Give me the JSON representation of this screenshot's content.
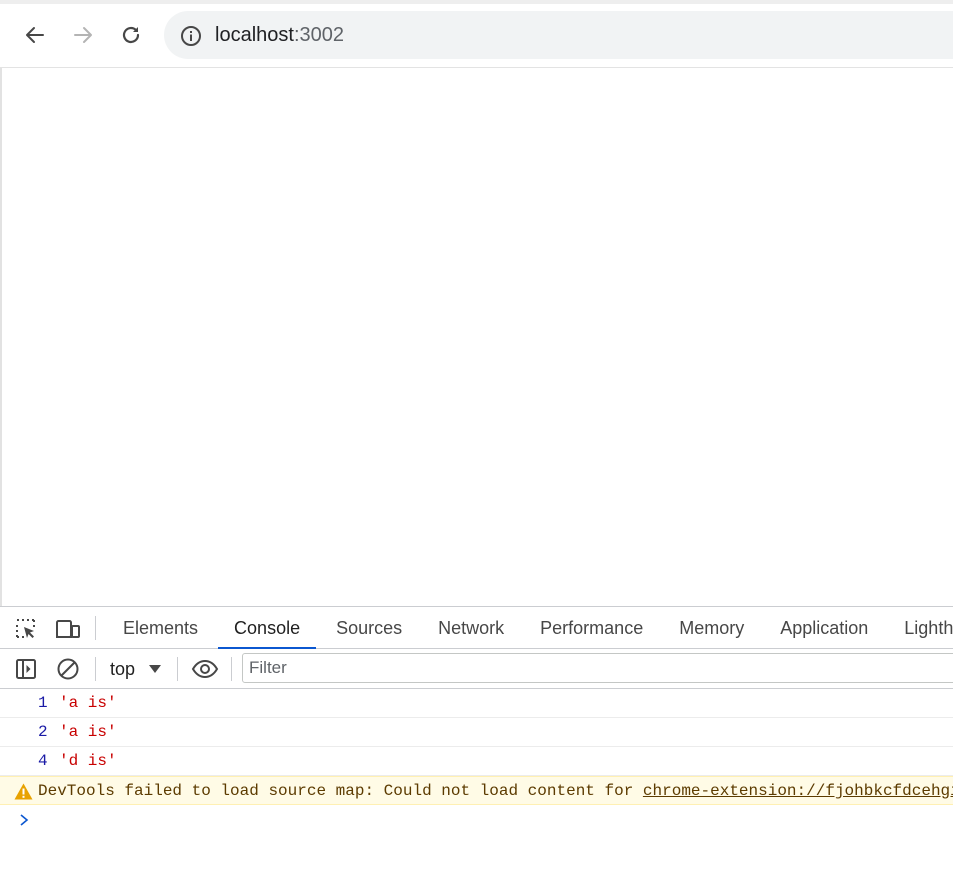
{
  "browser": {
    "url_host": "localhost",
    "url_port": ":3002",
    "icons": [
      "back-icon",
      "forward-icon",
      "reload-icon",
      "site-info-icon"
    ]
  },
  "devtools": {
    "tabs": [
      {
        "label": "Elements",
        "active": false
      },
      {
        "label": "Console",
        "active": true
      },
      {
        "label": "Sources",
        "active": false
      },
      {
        "label": "Network",
        "active": false
      },
      {
        "label": "Performance",
        "active": false
      },
      {
        "label": "Memory",
        "active": false
      },
      {
        "label": "Application",
        "active": false
      },
      {
        "label": "Lighthouse",
        "active": false
      }
    ],
    "console_toolbar": {
      "context": "top",
      "filter_placeholder": "Filter"
    },
    "console": {
      "logs": [
        {
          "number": "1",
          "text": "'a is'"
        },
        {
          "number": "2",
          "text": "'a is'"
        },
        {
          "number": "4",
          "text": "'d is'"
        }
      ],
      "warning": {
        "text": "DevTools failed to load source map: Could not load content for ",
        "link": "chrome-extension://fjohbkcfdcehgiaaokkfejmebmhbbmao/"
      }
    }
  },
  "colors": {
    "accent": "#0b57d0",
    "log_number": "#1a1aa6",
    "log_string": "#c80000",
    "warning_bg": "#fffbe6",
    "warning_icon": "#e8a200"
  }
}
